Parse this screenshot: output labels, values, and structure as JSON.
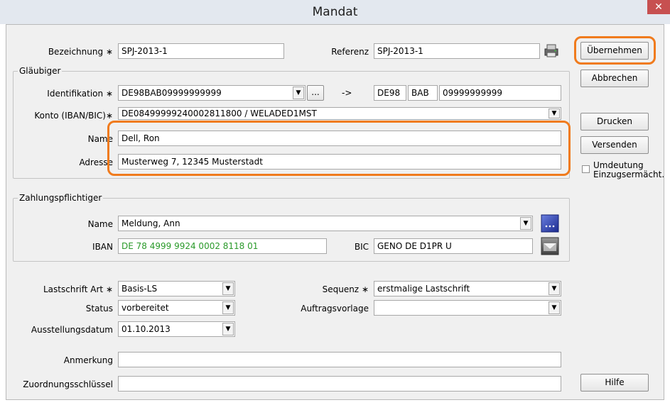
{
  "window": {
    "title": "Mandat",
    "close_glyph": "✕"
  },
  "header": {
    "bezeichnung_label": "Bezeichnung",
    "bezeichnung_value": "SPJ-2013-1",
    "referenz_label": "Referenz",
    "referenz_value": "SPJ-2013-1",
    "required_mark": "∗"
  },
  "glaeubiger": {
    "group_label": "Gläubiger",
    "identifikation_label": "Identifikation",
    "identifikation_value": "DE98BAB09999999999",
    "dots": "...",
    "arrow": "->",
    "id_part1": "DE98",
    "id_part2": "BAB",
    "id_part3": "09999999999",
    "konto_label": "Konto (IBAN/BIC)",
    "konto_value": "DE08499999240002811800 / WELADED1MST",
    "name_label": "Name",
    "name_value": "Dell, Ron",
    "adresse_label": "Adresse",
    "adresse_value": "Musterweg 7, 12345 Musterstadt"
  },
  "zahlungspflichtiger": {
    "group_label": "Zahlungspflichtiger",
    "name_label": "Name",
    "name_value": "Meldung, Ann",
    "iban_label": "IBAN",
    "iban_value": "DE 78 4999 9924 0002 8118 01",
    "bic_label": "BIC",
    "bic_value": "GENO DE D1PR U"
  },
  "lastschrift": {
    "art_label": "Lastschrift Art",
    "art_value": "Basis-LS",
    "status_label": "Status",
    "status_value": "vorbereitet",
    "ausstellungsdatum_label": "Ausstellungsdatum",
    "ausstellungsdatum_value": "01.10.2013",
    "sequenz_label": "Sequenz",
    "sequenz_value": "erstmalige Lastschrift",
    "auftragsvorlage_label": "Auftragsvorlage",
    "auftragsvorlage_value": "",
    "anmerkung_label": "Anmerkung",
    "anmerkung_value": "",
    "zuordnung_label": "Zuordnungsschlüssel",
    "zuordnung_value": ""
  },
  "buttons": {
    "uebernehmen": "Übernehmen",
    "abbrechen": "Abbrechen",
    "drucken": "Drucken",
    "versenden": "Versenden",
    "hilfe": "Hilfe"
  },
  "umdeutung": {
    "line1": "Umdeutung",
    "line2": "Einzugsermächt."
  },
  "colors": {
    "highlight": "#f07b1d",
    "iban_text": "#2a9a2a"
  }
}
